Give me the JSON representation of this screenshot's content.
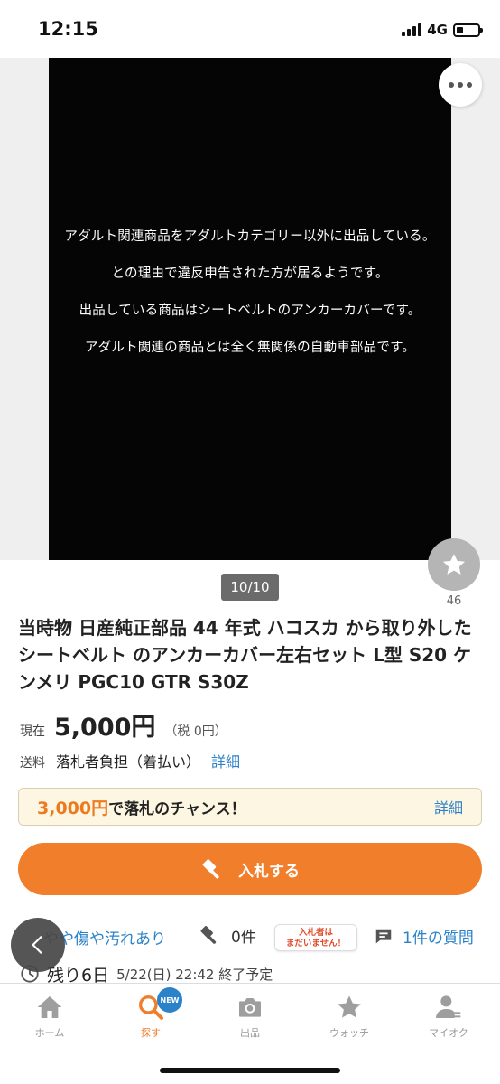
{
  "status_bar": {
    "time": "12:15",
    "network": "4G"
  },
  "image": {
    "lines": [
      "アダルト関連商品をアダルトカテゴリー以外に出品している。",
      "との理由で違反申告された方が居るようです。",
      "出品している商品はシートベルトのアンカーカバーです。",
      "アダルト関連の商品とは全く無関係の自動車部品です。"
    ],
    "counter": "10/10",
    "watch_count": "46"
  },
  "item": {
    "title": "当時物 日産純正部品 44 年式 ハコスカ から取り外した シートベルト のアンカーカバー左右セット L型 S20 ケンメリ PGC10 GTR S30Z",
    "price_label": "現在",
    "price": "5,000円",
    "tax": "（税 0円）",
    "shipping_label": "送料",
    "shipping_value": "落札者負担（着払い）",
    "shipping_link": "詳細"
  },
  "chance": {
    "price": "3,000円",
    "text": "で落札のチャンス！",
    "link": "詳細"
  },
  "bid_button": {
    "label": "入札する"
  },
  "info": {
    "condition": "やや傷や汚れあり",
    "bids": "0件",
    "no_bid_line1": "入札者は",
    "no_bid_line2": "まだいません！",
    "questions": "1件の質問",
    "remaining": "残り6日",
    "end_time": "5/22(日) 22:42 終了予定"
  },
  "tabs": [
    {
      "label": "ホーム",
      "icon": "home-icon"
    },
    {
      "label": "探す",
      "icon": "search-icon",
      "badge": "NEW"
    },
    {
      "label": "出品",
      "icon": "camera-icon"
    },
    {
      "label": "ウォッチ",
      "icon": "star-icon"
    },
    {
      "label": "マイオク",
      "icon": "user-icon"
    }
  ],
  "colors": {
    "accent": "#f07e2a",
    "link": "#2c82c9",
    "chance_bg": "#fdf6e2"
  }
}
